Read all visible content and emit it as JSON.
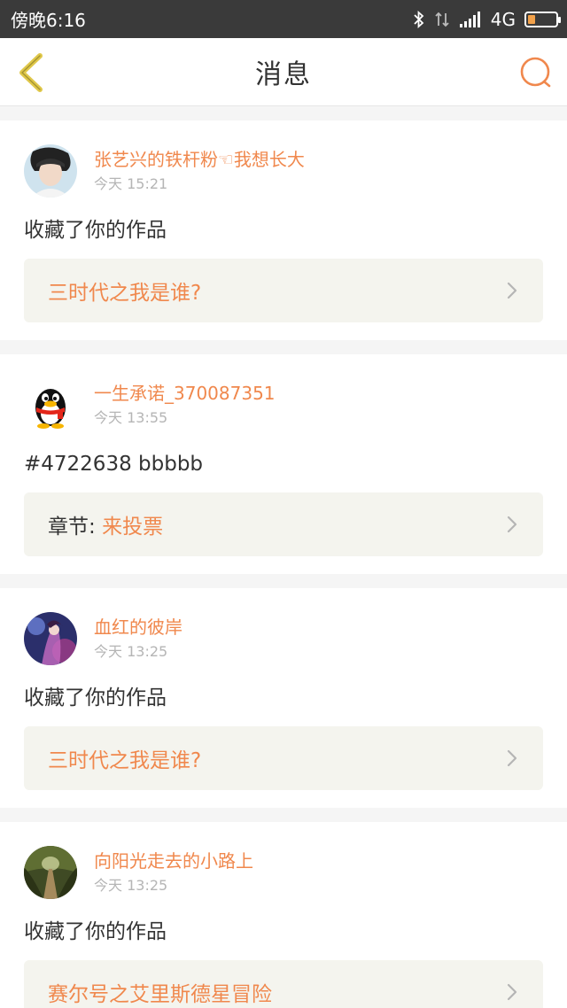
{
  "status_bar": {
    "time": "傍晚6:16",
    "network": "4G",
    "battery_level": 0.25,
    "battery_color": "#f2a14a"
  },
  "nav": {
    "title": "消息"
  },
  "colors": {
    "accent": "#f0884d",
    "link_bg": "#f4f4ee",
    "back_arrow": "#e0c84a"
  },
  "messages": [
    {
      "user": "张艺兴的铁杆粉☜我想长大",
      "time": "今天 15:21",
      "body": "收藏了你的作品",
      "link_prefix": "",
      "link_text": "三时代之我是谁?"
    },
    {
      "user": "一生承诺_370087351",
      "time": "今天 13:55",
      "body": "#4722638 bbbbb",
      "link_prefix": "章节: ",
      "link_text": "来投票"
    },
    {
      "user": "血红的彼岸",
      "time": "今天 13:25",
      "body": "收藏了你的作品",
      "link_prefix": "",
      "link_text": "三时代之我是谁?"
    },
    {
      "user": "向阳光走去的小路上",
      "time": "今天 13:25",
      "body": "收藏了你的作品",
      "link_prefix": "",
      "link_text": "赛尔号之艾里斯德星冒险"
    }
  ]
}
